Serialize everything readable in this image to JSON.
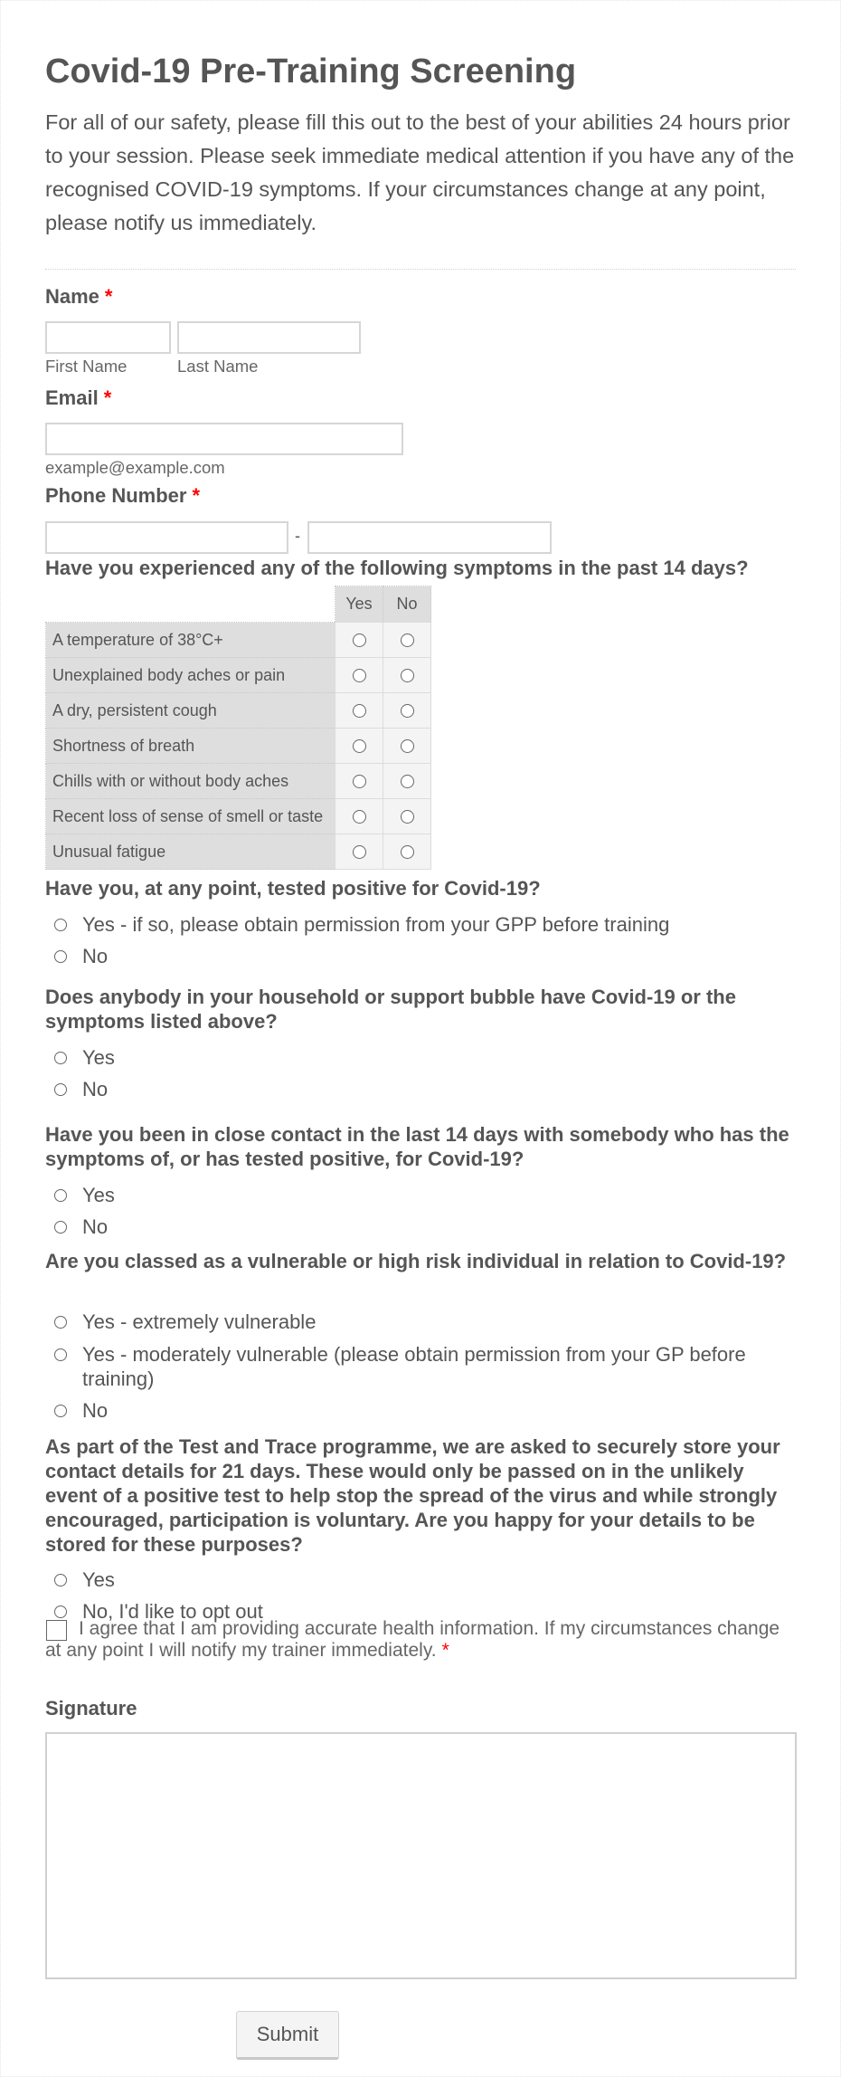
{
  "form": {
    "title": "Covid-19 Pre-Training Screening",
    "intro": "For all of our safety, please fill this out to the best of your abilities 24 hours prior to your session. Please seek immediate medical attention if you have any of the recognised COVID-19 symptoms. If your circumstances change at any point, please notify us immediately.",
    "required_marker": "*",
    "accent_required": "#ff0000"
  },
  "name": {
    "label": "Name",
    "first_value": "",
    "last_value": "",
    "first_sublabel": "First Name",
    "last_sublabel": "Last Name"
  },
  "email": {
    "label": "Email",
    "value": "",
    "sublabel": "example@example.com"
  },
  "phone": {
    "label": "Phone Number",
    "area_value": "",
    "number_value": "",
    "separator": "-"
  },
  "symptoms": {
    "label": "Have you experienced any of the following symptoms in the past 14 days?",
    "columns": [
      "Yes",
      "No"
    ],
    "rows": [
      "A temperature of 38°C+",
      "Unexplained body aches or pain",
      "A dry, persistent cough",
      "Shortness of breath",
      "Chills with or without body aches",
      "Recent loss of sense of smell or taste",
      "Unusual fatigue"
    ]
  },
  "questions": [
    {
      "label": "Have you, at any point, tested positive for Covid-19?",
      "options": [
        "Yes - if so, please obtain permission from your GPP before training",
        "No"
      ]
    },
    {
      "label": "Does anybody in your household or support bubble have Covid-19 or the symptoms listed above?",
      "options": [
        "Yes",
        "No"
      ]
    },
    {
      "label": "Have you been in close contact in the last 14 days with somebody who has the symptoms of, or has tested positive, for Covid-19?",
      "options": [
        "Yes",
        "No"
      ]
    },
    {
      "label": "Are you classed as a vulnerable or high risk individual in relation to Covid-19?",
      "options": [
        "Yes - extremely vulnerable",
        "Yes - moderately vulnerable (please obtain permission from your GP before training)",
        "No"
      ]
    },
    {
      "label": "As part of the Test and Trace programme, we are asked to securely store your contact details for 21 days. These would only be passed on in the unlikely event of a positive test to help stop the spread of the virus and while strongly encouraged, participation is voluntary. Are you happy for your details to be stored for these purposes?",
      "options": [
        "Yes",
        "No, I'd like to opt out"
      ]
    }
  ],
  "consent": {
    "text": "I agree that I am providing accurate health information. If my circumstances change at any point I will notify my trainer immediately.",
    "checked": false
  },
  "signature": {
    "label": "Signature"
  },
  "submit": {
    "label": "Submit"
  }
}
